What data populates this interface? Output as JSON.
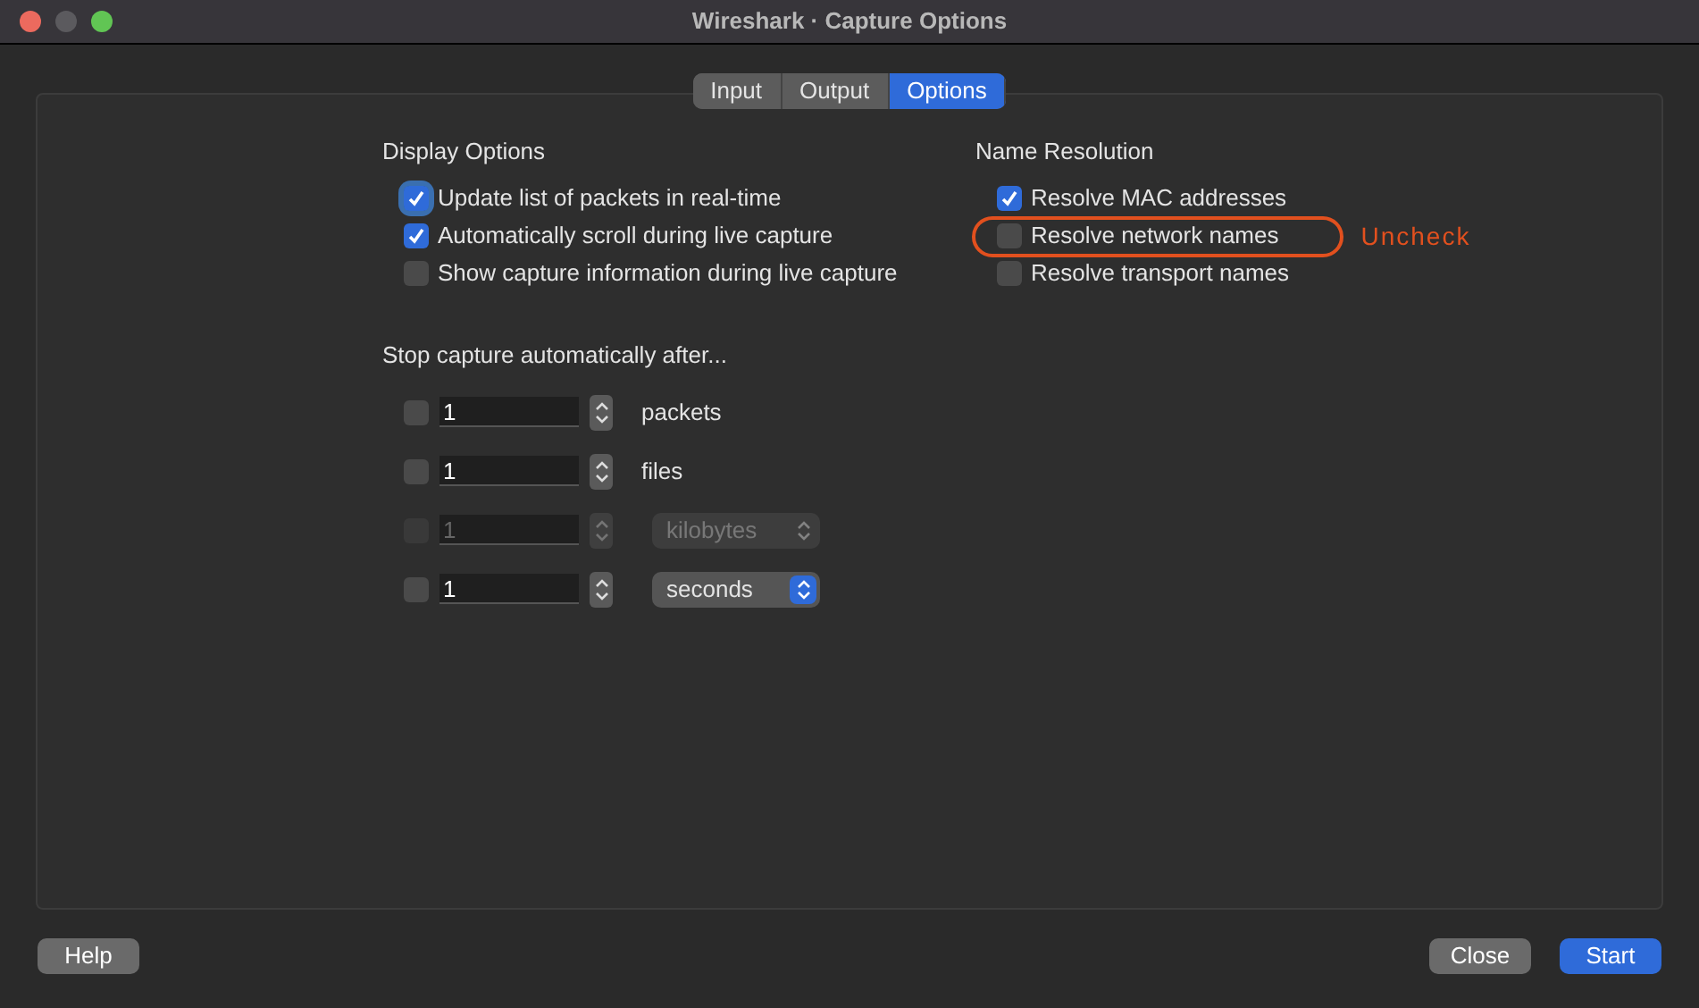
{
  "window": {
    "title": "Wireshark · Capture Options"
  },
  "tabs": [
    {
      "label": "Input",
      "selected": false
    },
    {
      "label": "Output",
      "selected": false
    },
    {
      "label": "Options",
      "selected": true
    }
  ],
  "display_options": {
    "title": "Display Options",
    "items": [
      {
        "label": "Update list of packets in real-time",
        "checked": true,
        "focused": true
      },
      {
        "label": "Automatically scroll during live capture",
        "checked": true,
        "focused": false
      },
      {
        "label": "Show capture information during live capture",
        "checked": false,
        "focused": false
      }
    ]
  },
  "name_resolution": {
    "title": "Name Resolution",
    "items": [
      {
        "label": "Resolve MAC addresses",
        "checked": true
      },
      {
        "label": "Resolve network names",
        "checked": false,
        "annotation": "Uncheck"
      },
      {
        "label": "Resolve transport names",
        "checked": false
      }
    ]
  },
  "stop_capture": {
    "title": "Stop capture automatically after...",
    "rows": [
      {
        "checked": false,
        "disabled": false,
        "value": "1",
        "kind": "label",
        "unit": "packets"
      },
      {
        "checked": false,
        "disabled": false,
        "value": "1",
        "kind": "label",
        "unit": "files"
      },
      {
        "checked": false,
        "disabled": true,
        "value": "1",
        "kind": "dropdown",
        "unit": "kilobytes"
      },
      {
        "checked": false,
        "disabled": false,
        "value": "1",
        "kind": "dropdown",
        "unit": "seconds"
      }
    ]
  },
  "buttons": [
    {
      "label": "Help",
      "kind": "normal"
    },
    {
      "label": "Close",
      "kind": "normal"
    },
    {
      "label": "Start",
      "kind": "default"
    }
  ]
}
